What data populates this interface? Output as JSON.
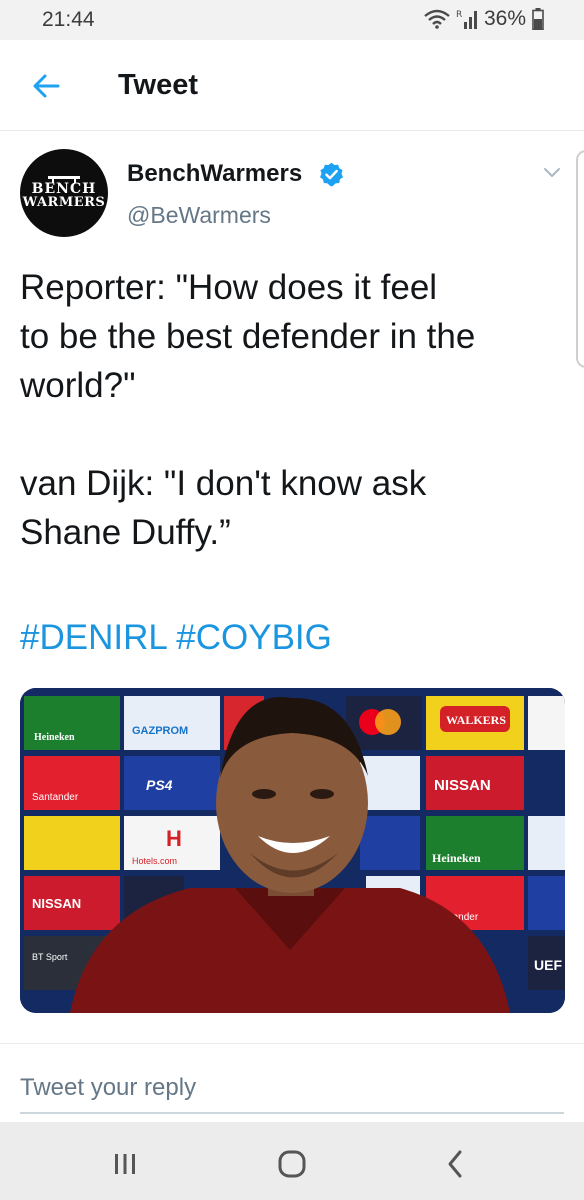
{
  "status_bar": {
    "time": "21:44",
    "battery": "36%"
  },
  "app_bar": {
    "title": "Tweet"
  },
  "tweet": {
    "avatar": {
      "logo_line1": "BENCH",
      "logo_line2": "WARMERS"
    },
    "display_name": "BenchWarmers",
    "handle": "@BeWarmers",
    "text": "Reporter: \"How does it feel\nto be the best defender in the\nworld?\"\n\nvan Dijk: \"I don't know ask\nShane Duffy.”",
    "hashtags": [
      "#DENIRL",
      "#COYBIG"
    ],
    "media": {
      "description": "Photo",
      "sponsors": {
        "heineken": "Heineken",
        "gazprom": "GAZPROM",
        "walkers": "WALKERS",
        "nissan": "NISSAN",
        "santander": "Santander",
        "hotels": "Hotels.com",
        "ps4": "PS4",
        "bt_sport": "BT Sport",
        "uefa": "UEF"
      }
    }
  },
  "reply": {
    "placeholder": "Tweet your reply"
  },
  "colors": {
    "link": "#1b95e0",
    "verified": "#1da1f2",
    "secondary": "#657786"
  }
}
